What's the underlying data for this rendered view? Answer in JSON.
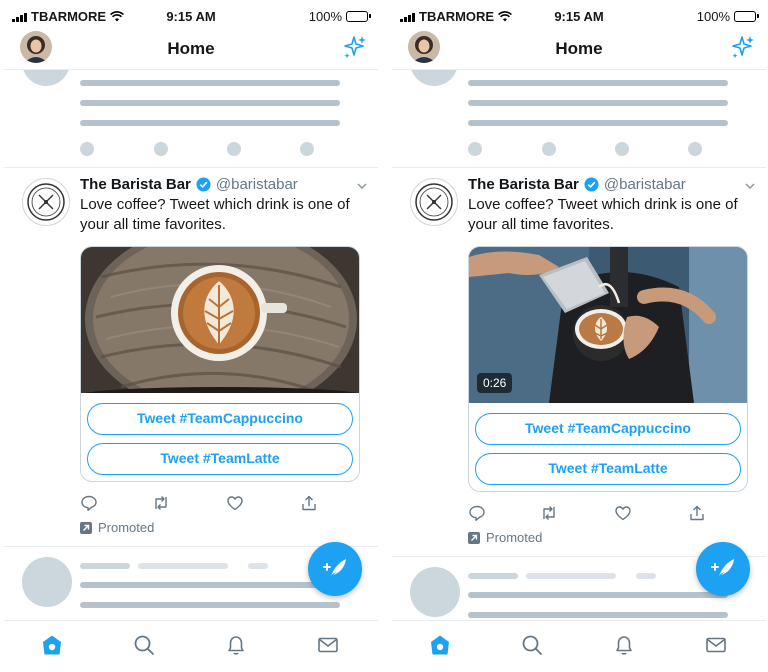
{
  "status_bar": {
    "carrier": "TBARMORE",
    "time": "9:15 AM",
    "battery": "100%"
  },
  "nav": {
    "title": "Home"
  },
  "tweet": {
    "name": "The Barista Bar",
    "handle": "@baristabar",
    "text": "Love coffee? Tweet which drink is one of your all time favorites.",
    "poll_option_1": "Tweet #TeamCappuccino",
    "poll_option_2": "Tweet #TeamLatte",
    "promoted_label": "Promoted",
    "video_duration": "0:26"
  },
  "icons": {
    "nav_left": "avatar",
    "nav_right": "sparkle-icon",
    "actions": [
      "reply-icon",
      "retweet-icon",
      "like-icon",
      "share-icon"
    ],
    "tabs": [
      "home-icon",
      "search-icon",
      "notifications-icon",
      "messages-icon"
    ],
    "fab": "compose-tweet-icon"
  },
  "colors": {
    "accent": "#1da1f2",
    "skeleton": "#ccd6dd",
    "text_secondary": "#657786"
  }
}
